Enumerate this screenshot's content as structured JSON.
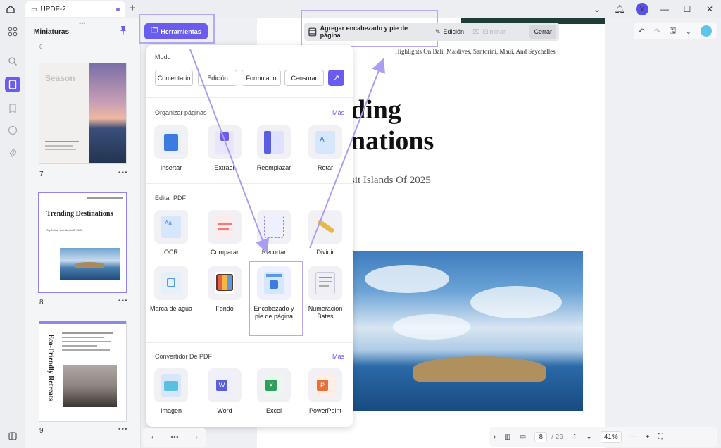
{
  "titlebar": {
    "tab_title": "UPDF-2"
  },
  "user": {
    "initial": "V"
  },
  "thumbnails": {
    "heading": "Miniaturas",
    "pages": [
      {
        "number": "7",
        "title": "Season"
      },
      {
        "number": "8",
        "title": "Trending Destinations",
        "subtitle": "Top 5 Must Visit Islands Of 2025"
      },
      {
        "number": "9",
        "title": "Eco-Friendly Retreats"
      }
    ],
    "top_partial_number": "6"
  },
  "toolbar": {
    "tools_button": "Herramientas",
    "header_footer": "Agregar encabezado y pie de página",
    "edit": "Edición",
    "delete": "Eliminar",
    "close": "Cerrar"
  },
  "dropdown": {
    "mode_title": "Modo",
    "modes": [
      "Comentario",
      "Edición",
      "Formulario",
      "Censurar"
    ],
    "organize_title": "Organizar páginas",
    "more": "Más",
    "organize_tools": [
      "Insertar",
      "Extraer",
      "Reemplazar",
      "Rotar"
    ],
    "edit_title": "Editar PDF",
    "edit_tools": [
      "OCR",
      "Comparar",
      "Recortar",
      "Dividir",
      "Marca de agua",
      "Fondo",
      "Encabezado y pie de página",
      "Numeración Bates"
    ],
    "convert_title": "Convertidor De PDF",
    "convert_tools": [
      "Imagen",
      "Word",
      "Excel",
      "PowerPoint"
    ]
  },
  "document": {
    "header_line": "Highlights On Bali, Maldives, Santorini, Maui, And Seychelles",
    "title_line1": "ding",
    "title_line2": "nations",
    "subtitle": "sit Islands Of 2025"
  },
  "bottom": {
    "current_page": "8",
    "total_pages": "/ 29",
    "zoom": "41%"
  },
  "colors": {
    "accent": "#6b5cf0",
    "highlight": "#b3a9f5"
  }
}
